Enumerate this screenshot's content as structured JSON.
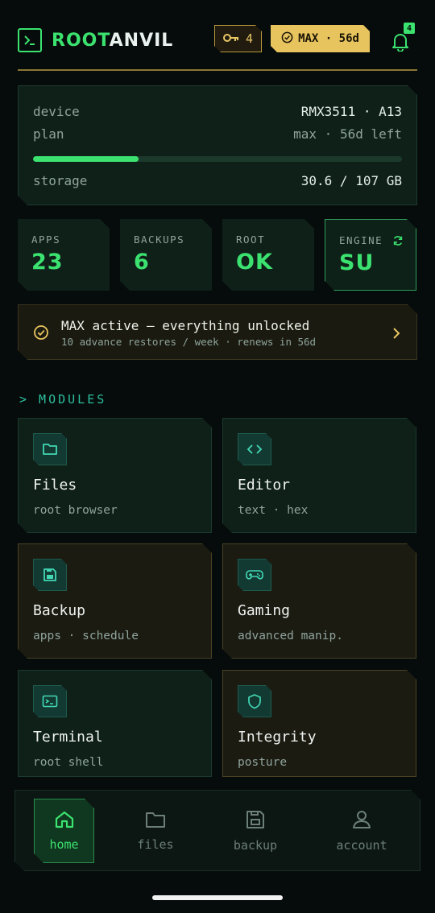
{
  "header": {
    "brand_a": "ROOT",
    "brand_b": "ANVIL",
    "keys": "4",
    "plan_badge": "MAX · 56d",
    "notif_count": "4"
  },
  "device_card": {
    "device_label": "device",
    "device_value": "RMX3511 · A13",
    "plan_label": "plan",
    "plan_value": "max · 56d left",
    "storage_label": "storage",
    "storage_value": "30.6 / 107 GB",
    "storage_fraction": 0.286
  },
  "stats": [
    {
      "label": "APPS",
      "value": "23"
    },
    {
      "label": "BACKUPS",
      "value": "6"
    },
    {
      "label": "ROOT",
      "value": "OK"
    },
    {
      "label": "ENGINE",
      "value": "SU"
    }
  ],
  "banner": {
    "title": "MAX active — everything unlocked",
    "subtitle": "10 advance restores / week · renews in 56d"
  },
  "section_title": "> MODULES",
  "modules": [
    {
      "title": "Files",
      "subtitle": "root browser",
      "icon": "folder-icon"
    },
    {
      "title": "Editor",
      "subtitle": "text · hex",
      "icon": "code-icon"
    },
    {
      "title": "Backup",
      "subtitle": "apps · schedule",
      "icon": "save-icon"
    },
    {
      "title": "Gaming",
      "subtitle": "advanced manip.",
      "icon": "gamepad-icon"
    },
    {
      "title": "Terminal",
      "subtitle": "root shell",
      "icon": "terminal-icon"
    },
    {
      "title": "Integrity",
      "subtitle": "posture",
      "icon": "shield-icon"
    }
  ],
  "nav": [
    {
      "label": "home",
      "active": true
    },
    {
      "label": "files",
      "active": false
    },
    {
      "label": "backup",
      "active": false
    },
    {
      "label": "account",
      "active": false
    }
  ],
  "colors": {
    "accent_green": "#3be26f",
    "gold": "#e8c45f",
    "teal": "#2dbf9e",
    "background": "#060c0b"
  }
}
